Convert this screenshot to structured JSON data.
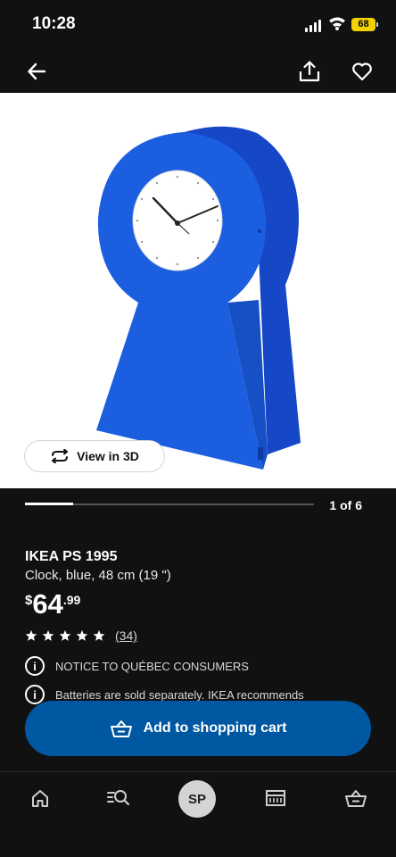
{
  "status_bar": {
    "time": "10:28",
    "battery": "68"
  },
  "icons": {
    "back": "arrow-left-icon",
    "share": "share-icon",
    "favorite": "heart-icon",
    "view3d": "rotate-icon",
    "info": "info-icon",
    "cart": "basket-icon",
    "home": "home-icon",
    "search": "search-icon",
    "store": "store-icon",
    "basket": "basket-icon"
  },
  "colors": {
    "accent": "#0058a3",
    "product": "#1d5ed8",
    "background": "#111111"
  },
  "product_image": {
    "view3d_label": "View in 3D"
  },
  "carousel": {
    "count_label": "1 of 6",
    "progress": 0.167
  },
  "product": {
    "name": "IKEA PS 1995",
    "description": "Clock, blue, 48 cm (19 \")",
    "price_currency": "$",
    "price_whole": "64",
    "price_decimal": ".99",
    "rating": 5,
    "reviews": "(34)"
  },
  "notices": [
    {
      "text": "NOTICE TO QUÉBEC CONSUMERS"
    },
    {
      "text": "Batteries are sold separately. IKEA recommends"
    }
  ],
  "cart_button": {
    "label": "Add to shopping cart"
  },
  "bottom_nav": {
    "avatar_initials": "SP"
  }
}
